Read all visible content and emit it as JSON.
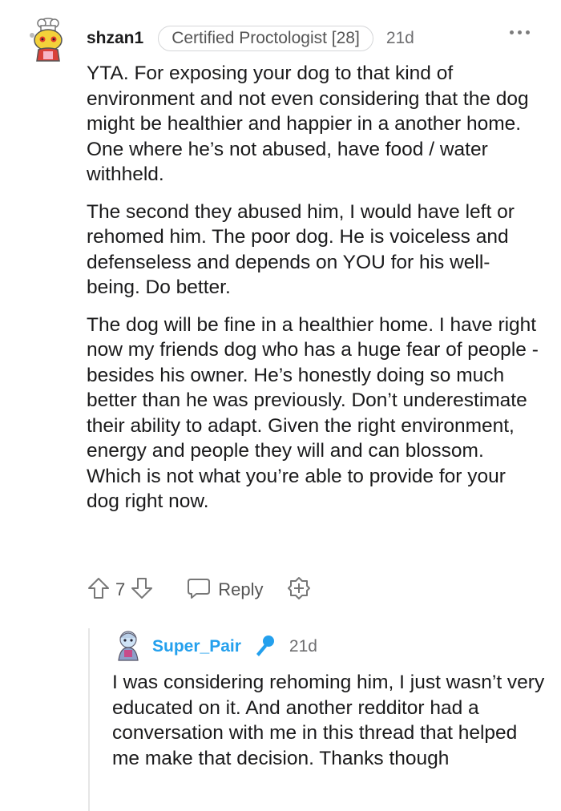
{
  "comment": {
    "username": "shzan1",
    "flair": "Certified Proctologist [28]",
    "time": "21d",
    "paragraphs": [
      "YTA. For exposing your dog to that kind of environment and not even considering that the dog might be healthier and happier in a another home. One where he’s not abused, have food / water withheld.",
      "The second they abused him, I would have left or rehomed him. The poor dog. He is voiceless and defenseless and depends on YOU for his well-being. Do better.",
      "The dog will be fine in a healthier home. I have right now my friends dog who has a huge fear of people - besides his owner. He’s honestly doing so much better than he was previously. Don’t underestimate their ability to adapt. Given the right environment, energy and people they will and can blossom. Which is not what you’re able to provide for your dog right now."
    ],
    "vote_count": "7",
    "reply_label": "Reply"
  },
  "reply": {
    "username": "Super_Pair",
    "time": "21d",
    "text": "I was considering rehoming him, I just wasn’t very educated on it. And another redditor had a conversation with me in this thread that helped me make that decision. Thanks though"
  },
  "icons": {
    "upvote": "arrow-up-outline-icon",
    "downvote": "arrow-down-outline-icon",
    "reply": "speech-bubble-icon",
    "award": "award-plus-icon",
    "more": "three-dots-icon",
    "op_badge": "microphone-icon"
  },
  "colors": {
    "op_username": "#24a0ed",
    "text": "#1a1a1b",
    "meta": "#6e6e70"
  }
}
